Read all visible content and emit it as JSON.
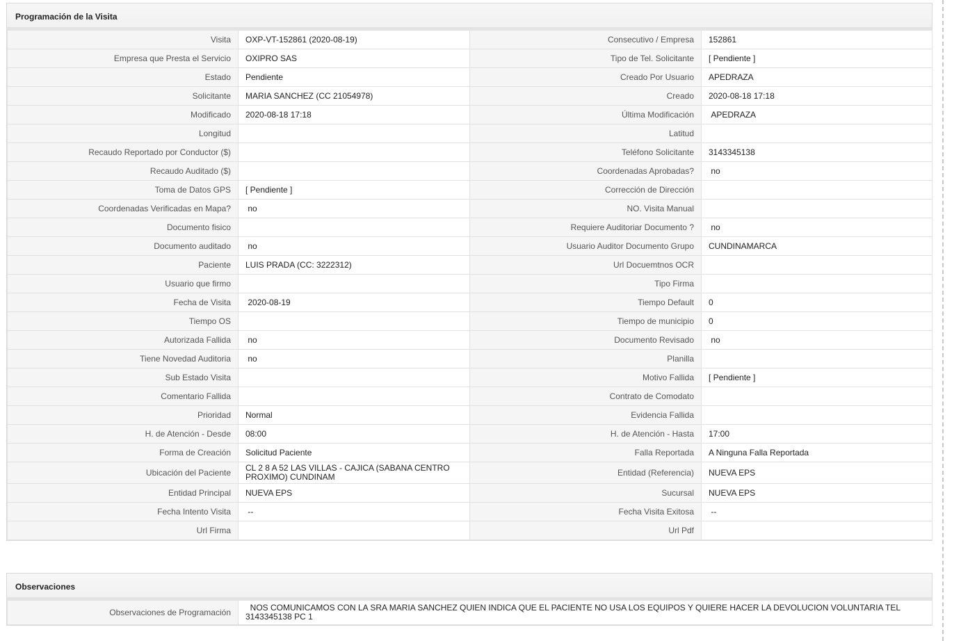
{
  "programacion": {
    "title": "Programación de la Visita",
    "rows": [
      {
        "l1": "Visita",
        "v1": "OXP-VT-152861 (2020-08-19)",
        "l2": "Consecutivo / Empresa",
        "v2": "152861"
      },
      {
        "l1": "Empresa que Presta el Servicio",
        "v1": "OXIPRO SAS",
        "l2": "Tipo de Tel. Solicitante",
        "v2": "[ Pendiente ]"
      },
      {
        "l1": "Estado",
        "v1": "Pendiente",
        "l2": "Creado Por Usuario",
        "v2": "APEDRAZA"
      },
      {
        "l1": "Solicitante",
        "v1": "MARIA SANCHEZ (CC 21054978)",
        "l2": "Creado",
        "v2": "2020-08-18 17:18"
      },
      {
        "l1": "Modificado",
        "v1": "2020-08-18 17:18",
        "l2": "Última Modificación",
        "v2": " APEDRAZA"
      },
      {
        "l1": "Longitud",
        "v1": "",
        "l2": "Latitud",
        "v2": ""
      },
      {
        "l1": "Recaudo Reportado por Conductor ($)",
        "v1": "",
        "l2": "Teléfono Solicitante",
        "v2": "3143345138"
      },
      {
        "l1": "Recaudo Auditado ($)",
        "v1": "",
        "l2": "Coordenadas Aprobadas?",
        "v2": " no"
      },
      {
        "l1": "Toma de Datos GPS",
        "v1": "[ Pendiente ]",
        "l2": "Corrección de Dirección",
        "v2": ""
      },
      {
        "l1": "Coordenadas Verificadas en Mapa?",
        "v1": " no",
        "l2": "NO. Visita Manual",
        "v2": ""
      },
      {
        "l1": "Documento fisico",
        "v1": "",
        "l2": "Requiere Auditoriar Documento ?",
        "v2": " no"
      },
      {
        "l1": "Documento auditado",
        "v1": " no",
        "l2": "Usuario Auditor Documento Grupo",
        "v2": "CUNDINAMARCA"
      },
      {
        "l1": "Paciente",
        "v1": "LUIS PRADA (CC: 3222312)",
        "l2": "Url Docuemtnos OCR",
        "v2": ""
      },
      {
        "l1": "Usuario que firmo",
        "v1": "",
        "l2": "Tipo Firma",
        "v2": ""
      },
      {
        "l1": "Fecha de Visita",
        "v1": " 2020-08-19",
        "l2": "Tiempo Default",
        "v2": "0"
      },
      {
        "l1": "Tiempo OS",
        "v1": "",
        "l2": "Tiempo de municipio",
        "v2": "0"
      },
      {
        "l1": "Autorizada Fallida",
        "v1": " no",
        "l2": "Documento Revisado",
        "v2": " no"
      },
      {
        "l1": "Tiene Novedad Auditoria",
        "v1": " no",
        "l2": "Planilla",
        "v2": ""
      },
      {
        "l1": "Sub Estado Visita",
        "v1": "",
        "l2": "Motivo Fallida",
        "v2": "[ Pendiente ]"
      },
      {
        "l1": "Comentario Fallida",
        "v1": "",
        "l2": "Contrato de Comodato",
        "v2": ""
      },
      {
        "l1": "Prioridad",
        "v1": "Normal",
        "l2": "Evidencia Fallida",
        "v2": ""
      },
      {
        "l1": "H. de Atención - Desde",
        "v1": "08:00",
        "l2": "H. de Atención - Hasta",
        "v2": "17:00"
      },
      {
        "l1": "Forma de Creación",
        "v1": "Solicitud Paciente",
        "l2": "Falla Reportada",
        "v2": "A Ninguna Falla Reportada"
      },
      {
        "l1": "Ubicación del Paciente",
        "v1": "CL 2 8 A 52 LAS VILLAS - CAJICA (SABANA CENTRO PROXIMO) CUNDINAM",
        "l2": "Entidad (Referencia)",
        "v2": "NUEVA EPS"
      },
      {
        "l1": "Entidad Principal",
        "v1": "NUEVA EPS",
        "l2": "Sucursal",
        "v2": "NUEVA EPS"
      },
      {
        "l1": "Fecha Intento Visita",
        "v1": " --",
        "l2": "Fecha Visita Exitosa",
        "v2": " --"
      },
      {
        "l1": "Url Firma",
        "v1": "",
        "l2": "Url Pdf",
        "v2": ""
      }
    ]
  },
  "observaciones": {
    "title": "Observaciones",
    "label": "Observaciones de Programación",
    "value": "  NOS COMUNICAMOS CON LA SRA MARIA SANCHEZ QUIEN INDICA QUE EL PACIENTE NO USA LOS EQUIPOS Y QUIERE HACER LA DEVOLUCION VOLUNTARIA TEL 3143345138 PC 1"
  }
}
